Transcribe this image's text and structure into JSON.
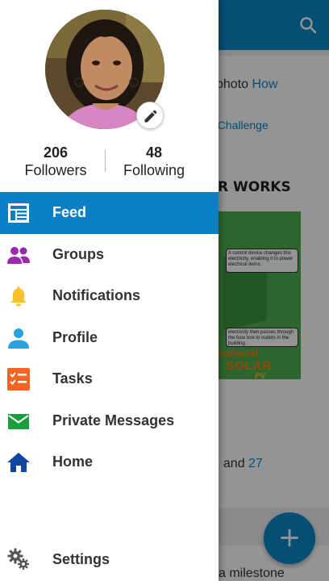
{
  "profile": {
    "followers_count": "206",
    "followers_label": "Followers",
    "following_count": "48",
    "following_label": "Following"
  },
  "menu": {
    "items": [
      {
        "label": "Feed",
        "icon": "feed-icon",
        "active": true
      },
      {
        "label": "Groups",
        "icon": "groups-icon",
        "active": false
      },
      {
        "label": "Notifications",
        "icon": "bell-icon",
        "active": false
      },
      {
        "label": "Profile",
        "icon": "person-icon",
        "active": false
      },
      {
        "label": "Tasks",
        "icon": "tasks-icon",
        "active": false
      },
      {
        "label": "Private Messages",
        "icon": "mail-icon",
        "active": false
      },
      {
        "label": "Home",
        "icon": "home-icon",
        "active": false
      }
    ],
    "settings_label": "Settings"
  },
  "background": {
    "line1_text": "photo ",
    "line1_link": "How",
    "line2_link": "n Challenge",
    "poster_title": "R WORKS",
    "poster_box1": "A control device changes this electricity, enabling it to power electrical items.",
    "poster_box2": "electricity then passes through the fuse box to outlets in the building.",
    "poster_national": "national",
    "poster_solar": "SOLAR",
    "poster_pv": "PV",
    "count_text": ", and ",
    "count_link": "27",
    "milestone_text": "a milestone",
    "fab_label": "+"
  },
  "colors": {
    "accent": "#0b7fc4",
    "groups_icon": "#9c27b0",
    "notifications_icon": "#fbc02d",
    "profile_icon": "#29a3e0",
    "tasks_icon": "#f26522",
    "messages_icon": "#1b9e3e",
    "home_icon": "#0d47a1"
  }
}
